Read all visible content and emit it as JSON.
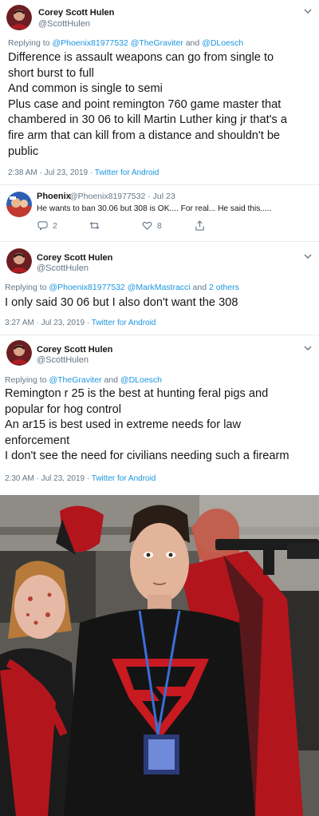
{
  "tweet1": {
    "name": "Corey Scott Hulen",
    "handle": "@ScottHulen",
    "replying_prefix": "Replying to ",
    "replying_1": "@Phoenix81977532",
    "replying_2": "@TheGraviter",
    "replying_and": " and ",
    "replying_3": "@DLoesch",
    "lines": [
      "Difference is assault weapons can go from single to",
      "short burst to full",
      "And common is single to semi",
      "Plus case and point remington 760 game master that",
      "chambered in 30 06  to kill Martin Luther king jr that's a",
      "fire arm that can kill from a distance and shouldn't be",
      "public"
    ],
    "time": "2:38 AM · Jul 23, 2019 · ",
    "source": "Twitter for Android"
  },
  "tweet2": {
    "name": "Phoenix",
    "handle_time": "@Phoenix81977532 · Jul 23",
    "text": "He wants to ban 30.06 but 308 is OK.... For real... He said this.....",
    "replies": "2",
    "retweets": "",
    "likes": "8"
  },
  "tweet3": {
    "name": "Corey Scott Hulen",
    "handle": "@ScottHulen",
    "replying_prefix": "Replying to ",
    "replying_1": "@Phoenix81977532",
    "replying_2": "@MarkMastracci",
    "replying_and": " and ",
    "replying_3": "2 others",
    "text": "I only said 30 06 but I also don't want the 308",
    "time": "3:27 AM · Jul 23, 2019 · ",
    "source": "Twitter for Android"
  },
  "tweet4": {
    "name": "Corey Scott Hulen",
    "handle": "@ScottHulen",
    "replying_prefix": "Replying to ",
    "replying_1": "@TheGraviter",
    "replying_and": " and ",
    "replying_2": "@DLoesch",
    "lines": [
      "Remington r 25 is the best at hunting feral pigs and",
      "popular for hog control",
      "An ar15 is best used in extreme needs for law",
      "enforcement",
      "I don't see the need for civilians needing such a firearm"
    ],
    "time": "2:30 AM · Jul 23, 2019 · ",
    "source": "Twitter for Android"
  },
  "colors": {
    "link": "#1b95e0",
    "secondary": "#657786",
    "separator": "#e6ecf0"
  },
  "icons": [
    "chevron-down-icon",
    "reply-icon",
    "retweet-icon",
    "like-icon",
    "share-icon"
  ]
}
